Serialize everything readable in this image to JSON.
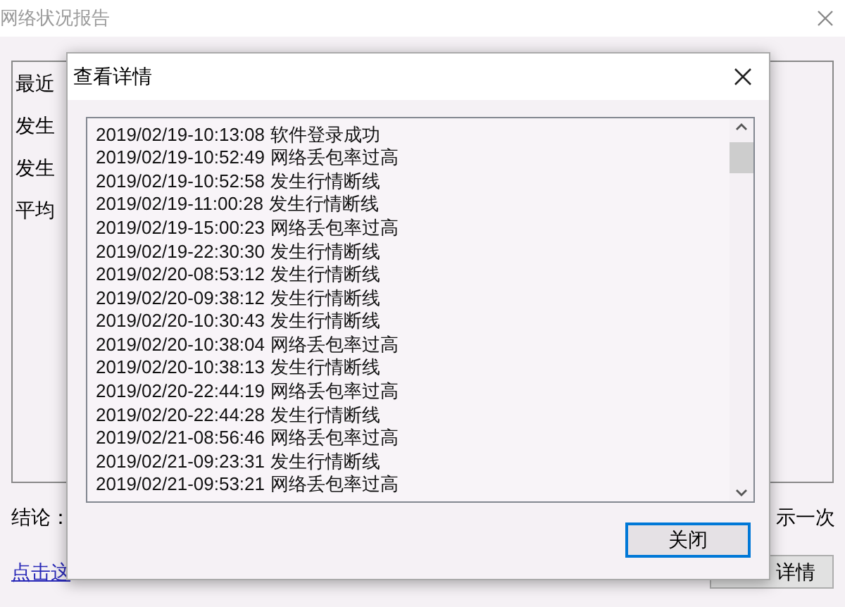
{
  "window": {
    "title": "网络状况报告",
    "summary_lines": [
      "最近",
      "发生",
      "发生",
      "平均"
    ],
    "conclusion_label": "结论：",
    "conclusion_tail": "示一次",
    "link": "点击这",
    "details_button": "详情"
  },
  "dialog": {
    "title": "查看详情",
    "entries": [
      {
        "time": "2019/02/19-10:13:08",
        "event": "软件登录成功"
      },
      {
        "time": "2019/02/19-10:52:49",
        "event": "网络丢包率过高"
      },
      {
        "time": "2019/02/19-10:52:58",
        "event": "发生行情断线"
      },
      {
        "time": "2019/02/19-11:00:28",
        "event": "发生行情断线"
      },
      {
        "time": "2019/02/19-15:00:23",
        "event": "网络丢包率过高"
      },
      {
        "time": "2019/02/19-22:30:30",
        "event": "发生行情断线"
      },
      {
        "time": "2019/02/20-08:53:12",
        "event": "发生行情断线"
      },
      {
        "time": "2019/02/20-09:38:12",
        "event": "发生行情断线"
      },
      {
        "time": "2019/02/20-10:30:43",
        "event": "发生行情断线"
      },
      {
        "time": "2019/02/20-10:38:04",
        "event": "网络丢包率过高"
      },
      {
        "time": "2019/02/20-10:38:13",
        "event": "发生行情断线"
      },
      {
        "time": "2019/02/20-22:44:19",
        "event": "网络丢包率过高"
      },
      {
        "time": "2019/02/20-22:44:28",
        "event": "发生行情断线"
      },
      {
        "time": "2019/02/21-08:56:46",
        "event": "网络丢包率过高"
      },
      {
        "time": "2019/02/21-09:23:31",
        "event": "发生行情断线"
      },
      {
        "time": "2019/02/21-09:53:21",
        "event": "网络丢包率过高"
      }
    ],
    "close_button": "关闭"
  }
}
